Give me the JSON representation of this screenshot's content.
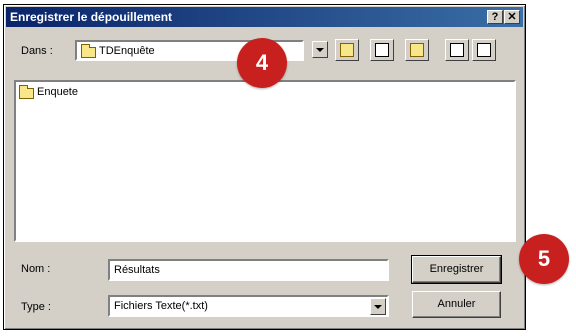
{
  "dialog": {
    "title": "Enregistrer le dépouillement",
    "help_glyph": "?",
    "close_glyph": "✕"
  },
  "location": {
    "label": "Dans :",
    "value": "TDEnquête",
    "icon": "folder-icon"
  },
  "toolbar": {
    "icons": [
      "up-folder-icon",
      "desktop-icon",
      "new-folder-icon",
      "list-view-icon",
      "details-view-icon"
    ]
  },
  "files": [
    {
      "name": "Enquete",
      "icon": "folder-icon"
    }
  ],
  "filename": {
    "label": "Nom :",
    "value": "Résultats"
  },
  "filetype": {
    "label": "Type :",
    "value": "Fichiers Texte(*.txt)"
  },
  "buttons": {
    "save": "Enregistrer",
    "cancel": "Annuler"
  },
  "badges": {
    "step_a": "4",
    "step_b": "5"
  },
  "colors": {
    "titlebar_start": "#0a246a",
    "titlebar_end": "#3a6ea5",
    "badge": "#c8201e",
    "face": "#d4d0c8"
  }
}
